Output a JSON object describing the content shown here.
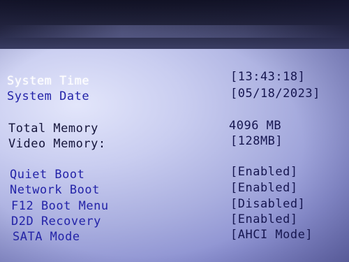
{
  "settings": {
    "system_time": {
      "label": "System Time",
      "value": "[13:43:18]"
    },
    "system_date": {
      "label": "System Date",
      "value": "[05/18/2023]"
    },
    "total_memory": {
      "label": "Total Memory",
      "value": "4096 MB"
    },
    "video_memory": {
      "label": "Video Memory:",
      "value": "[128MB]"
    },
    "quiet_boot": {
      "label": "Quiet Boot",
      "value": "[Enabled]"
    },
    "network_boot": {
      "label": "Network Boot",
      "value": "[Enabled]"
    },
    "f12_boot_menu": {
      "label": "F12 Boot Menu",
      "value": "[Disabled]"
    },
    "d2d_recovery": {
      "label": "D2D Recovery",
      "value": "[Enabled]"
    },
    "sata_mode": {
      "label": "SATA Mode",
      "value": "[AHCI Mode]"
    }
  },
  "colors": {
    "selected": "#ffffff",
    "option_label": "#2323a8",
    "info_label": "#14143a",
    "value_text": "#161650"
  }
}
